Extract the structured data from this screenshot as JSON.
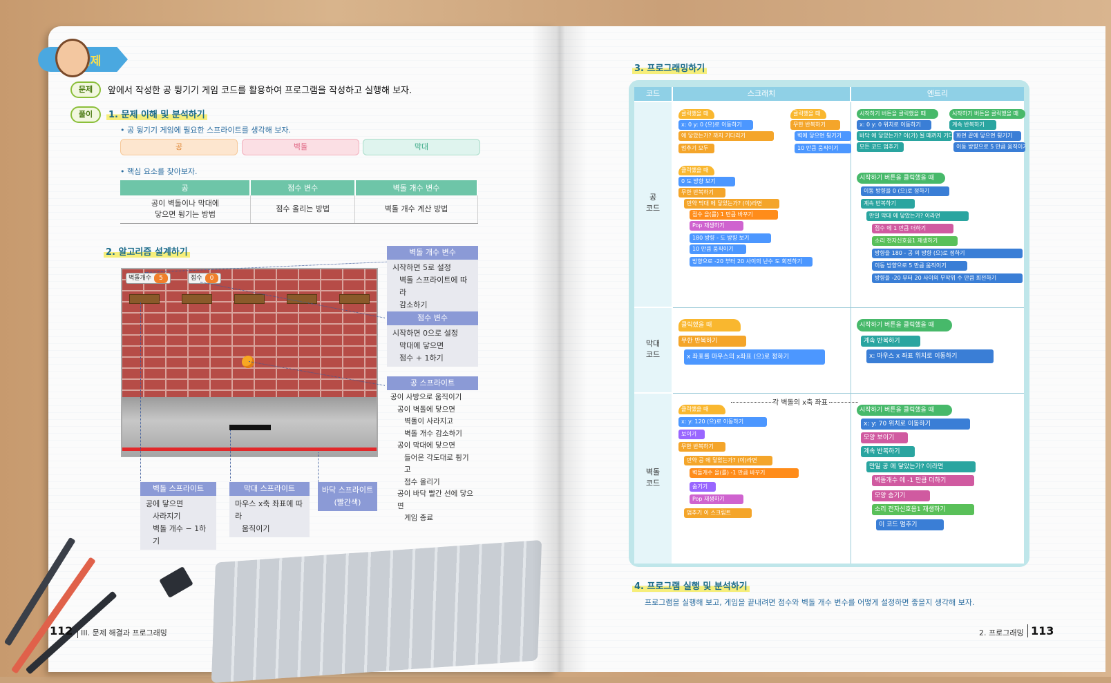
{
  "left_page": {
    "badge": "예제",
    "problem_tag": "문제",
    "problem_text": "앞에서 작성한 공 튕기기 게임 코드를 활용하여 프로그램을 작성하고 실행해 보자.",
    "solution_tag": "풀이",
    "step1_title": "1. 문제 이해 및 분석하기",
    "step1_note": "• 공 튕기기 게임에 필요한 스프라이트를 생각해 보자.",
    "sprites": [
      "공",
      "벽돌",
      "막대"
    ],
    "core_note": "• 핵심 요소를 찾아보자.",
    "table_headers": [
      "공",
      "점수 변수",
      "벽돌 개수 변수"
    ],
    "table_cells": [
      "공이 벽돌이나 막대에\n닿으면 튕기는 방법",
      "점수 올리는 방법",
      "벽돌 개수 계산 방법"
    ],
    "step2_title": "2. 알고리즘 설계하기",
    "hud_bricks_label": "벽돌개수",
    "hud_bricks_value": "5",
    "hud_score_label": "점수",
    "hud_score_value": "0",
    "callouts": {
      "brick_var": {
        "title": "벽돌 개수 변수",
        "lines": [
          "시작하면 5로 설정",
          "벽돌 스프라이트에 따라",
          "감소하기"
        ]
      },
      "score_var": {
        "title": "점수 변수",
        "lines": [
          "시작하면 0으로 설정",
          "막대에 닿으면",
          "점수 + 1하기"
        ]
      },
      "ball_sprite": {
        "title": "공 스프라이트",
        "lines": [
          "공이 사방으로 움직이기",
          "공이 벽돌에 닿으면",
          "벽돌이 사라지고",
          "벽돌 개수 감소하기",
          "공이 막대에 닿으면",
          "들어온 각도대로 튕기고",
          "점수 올리기",
          "공이 바닥 빨간 선에 닿으면",
          "게임 종료"
        ]
      },
      "brick_sprite": {
        "title": "벽돌 스프라이트",
        "lines": [
          "공에 닿으면",
          "사라지기",
          "벽돌 개수 − 1하기"
        ]
      },
      "paddle_sprite": {
        "title": "막대 스프라이트",
        "lines": [
          "마우스 x축 좌표에 따라",
          "움직이기"
        ]
      },
      "floor_sprite": {
        "title": "바닥 스프라이트",
        "subtitle": "(빨간색)"
      }
    },
    "page_number": "112",
    "page_chapter": "III. 문제 해결과 프로그래밍"
  },
  "right_page": {
    "step3_title": "3. 프로그래밍하기",
    "col_headers": [
      "코드",
      "스크래치",
      "엔트리"
    ],
    "row_labels": [
      "공\n코드",
      "막대\n코드",
      "벽돌\n코드"
    ],
    "brick_annotation": "각 벽돌의 x축 좌표",
    "scratch_ball": [
      "클릭했을 때",
      "x: 0 y: 0 (으)로 이동하기",
      "에 닿았는가? 까지 기다리기",
      "멈추기 모두",
      "클릭했을 때",
      "무한 반복하기",
      "벽에 닿으면 튕기기",
      "10 만큼 움직이기",
      "클릭했을 때",
      "0 도 방향 보기",
      "무한 반복하기",
      "만약 막대 에 닿았는가? (이)라면",
      "점수 을(를) 1 만큼 바꾸기",
      "Pop 재생하기",
      "180 방향 - 도 방향 보기",
      "10 만큼 움직이기",
      "방향으로 -20 부터 20 사이의 난수 도 회전하기"
    ],
    "entry_ball": [
      "시작하기 버튼을 클릭했을 때",
      "x: 0 y: 0 위치로 이동하기",
      "바닥 에 닿았는가? 이(가) 될 때까지 기다리기",
      "모든 코드 멈추기",
      "시작하기 버튼을 클릭했을 때",
      "계속 반복하기",
      "화면 끝에 닿으면 튕기기",
      "이동 방향으로 5 만큼 움직이기",
      "시작하기 버튼을 클릭했을 때",
      "이동 방향을 0 (으)로 정하기",
      "계속 반복하기",
      "만일 막대 에 닿았는가? 이라면",
      "점수 에 1 만큼 더하기",
      "소리 전자신호음1 재생하기",
      "방향을 180 - 공 의 방향 (으)로 정하기",
      "이동 방향으로 5 만큼 움직이기",
      "방향을 -20 부터 20 사이의 무작위 수 만큼 회전하기"
    ],
    "scratch_paddle": [
      "클릭했을 때",
      "무한 반복하기",
      "x 좌표를 마우스의 x좌표 (으)로 정하기"
    ],
    "entry_paddle": [
      "시작하기 버튼을 클릭했을 때",
      "계속 반복하기",
      "x: 마우스 x 좌표 위치로 이동하기"
    ],
    "scratch_brick": [
      "클릭했을 때",
      "x: y: 120 (으)로 이동하기",
      "보이기",
      "무한 반복하기",
      "만약 공 에 닿았는가? (이)라면",
      "벽돌개수 을(를) -1 만큼 바꾸기",
      "숨기기",
      "Pop 재생하기",
      "멈추기 이 스크립트"
    ],
    "entry_brick": [
      "시작하기 버튼을 클릭했을 때",
      "x: y: 70 위치로 이동하기",
      "모양 보이기",
      "계속 반복하기",
      "만일 공 에 닿았는가? 이라면",
      "벽돌개수 에 -1 만큼 더하기",
      "모양 숨기기",
      "소리 전자신호음1 재생하기",
      "이 코드 멈추기"
    ],
    "step4_title": "4. 프로그램 실행 및 분석하기",
    "step4_text": "프로그램을 실행해 보고, 게임을 끝내려면 점수와 벽돌 개수 변수를 어떻게 설정하면 좋을지 생각해 보자.",
    "page_section": "2. 프로그래밍",
    "page_number": "113"
  }
}
